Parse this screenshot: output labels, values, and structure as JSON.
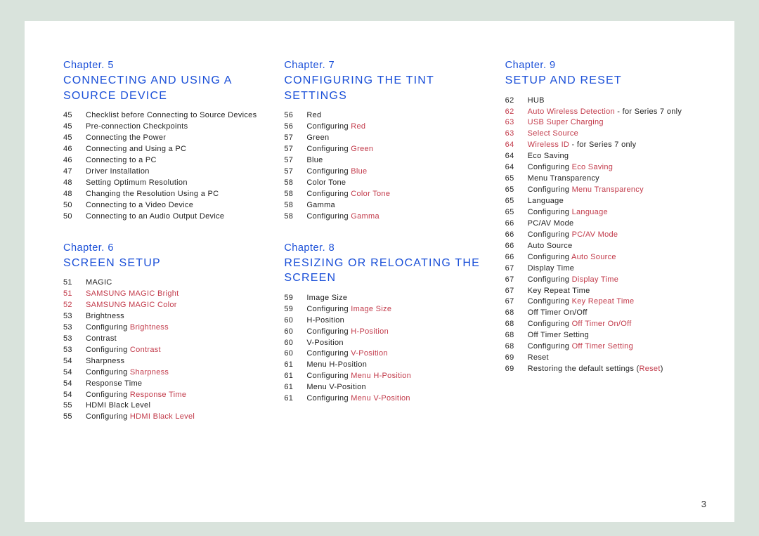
{
  "page_number": "3",
  "columns": [
    [
      {
        "num": "Chapter. 5",
        "title": "CONNECTING AND USING A SOURCE DEVICE",
        "items": [
          {
            "page": "45",
            "text": "Checklist before Connecting to Source Devices"
          },
          {
            "page": "45",
            "text": "Pre-connection Checkpoints"
          },
          {
            "page": "45",
            "text": "Connecting the Power"
          },
          {
            "page": "46",
            "text": "Connecting and Using a PC"
          },
          {
            "page": "46",
            "text": "Connecting to a PC"
          },
          {
            "page": "47",
            "text": "Driver Installation"
          },
          {
            "page": "48",
            "text": "Setting Optimum Resolution"
          },
          {
            "page": "48",
            "text": "Changing the Resolution Using a PC"
          },
          {
            "page": "50",
            "text": "Connecting to a Video Device"
          },
          {
            "page": "50",
            "text": "Connecting to an Audio Output Device"
          }
        ]
      },
      {
        "num": "Chapter. 6",
        "title": "SCREEN SETUP",
        "items": [
          {
            "page": "51",
            "text": "MAGIC"
          },
          {
            "page": "51",
            "text": "SAMSUNG MAGIC Bright",
            "style": "red"
          },
          {
            "page": "52",
            "text": "SAMSUNG MAGIC Color",
            "style": "red"
          },
          {
            "page": "53",
            "text": "Brightness"
          },
          {
            "page": "53",
            "prefix": "Configuring ",
            "red": "Brightness",
            "style": "mixed"
          },
          {
            "page": "53",
            "text": "Contrast"
          },
          {
            "page": "53",
            "prefix": "Configuring ",
            "red": "Contrast",
            "style": "mixed"
          },
          {
            "page": "54",
            "text": "Sharpness"
          },
          {
            "page": "54",
            "prefix": "Configuring ",
            "red": "Sharpness",
            "style": "mixed"
          },
          {
            "page": "54",
            "text": "Response Time"
          },
          {
            "page": "54",
            "prefix": "Configuring ",
            "red": "Response Time",
            "style": "mixed"
          },
          {
            "page": "55",
            "text": "HDMI Black Level"
          },
          {
            "page": "55",
            "prefix": "Configuring ",
            "red": "HDMI Black Level",
            "style": "mixed"
          }
        ]
      }
    ],
    [
      {
        "num": "Chapter. 7",
        "title": "CONFIGURING THE TINT SETTINGS",
        "items": [
          {
            "page": "56",
            "text": "Red"
          },
          {
            "page": "56",
            "prefix": "Configuring ",
            "red": "Red",
            "style": "mixed"
          },
          {
            "page": "57",
            "text": "Green"
          },
          {
            "page": "57",
            "prefix": "Configuring ",
            "red": "Green",
            "style": "mixed"
          },
          {
            "page": "57",
            "text": "Blue"
          },
          {
            "page": "57",
            "prefix": "Configuring ",
            "red": "Blue",
            "style": "mixed"
          },
          {
            "page": "58",
            "text": "Color Tone"
          },
          {
            "page": "58",
            "prefix": "Configuring ",
            "red": "Color Tone",
            "style": "mixed"
          },
          {
            "page": "58",
            "text": "Gamma"
          },
          {
            "page": "58",
            "prefix": "Configuring ",
            "red": "Gamma",
            "style": "mixed"
          }
        ]
      },
      {
        "num": "Chapter. 8",
        "title": "RESIZING OR RELOCATING THE SCREEN",
        "items": [
          {
            "page": "59",
            "text": "Image Size"
          },
          {
            "page": "59",
            "prefix": "Configuring ",
            "red": "Image Size",
            "style": "mixed"
          },
          {
            "page": "60",
            "text": "H-Position"
          },
          {
            "page": "60",
            "prefix": "Configuring ",
            "red": "H-Position",
            "style": "mixed"
          },
          {
            "page": "60",
            "text": "V-Position"
          },
          {
            "page": "60",
            "prefix": "Configuring ",
            "red": "V-Position",
            "style": "mixed"
          },
          {
            "page": "61",
            "text": "Menu H-Position"
          },
          {
            "page": "61",
            "prefix": "Configuring ",
            "red": "Menu H-Position",
            "style": "mixed"
          },
          {
            "page": "61",
            "text": "Menu V-Position"
          },
          {
            "page": "61",
            "prefix": "Configuring ",
            "red": "Menu V-Position",
            "style": "mixed"
          }
        ]
      }
    ],
    [
      {
        "num": "Chapter. 9",
        "title": "SETUP AND RESET",
        "items": [
          {
            "page": "62",
            "text": "HUB"
          },
          {
            "page": "62",
            "prefix": "",
            "red": "Auto Wireless Detection",
            "suffix": " - for Series 7 only",
            "style": "mixed2"
          },
          {
            "page": "63",
            "text": "USB Super Charging",
            "style": "red"
          },
          {
            "page": "63",
            "text": "Select Source",
            "style": "red"
          },
          {
            "page": "64",
            "prefix": "",
            "red": "Wireless ID",
            "suffix": " - for Series 7 only",
            "style": "mixed2"
          },
          {
            "page": "64",
            "text": "Eco Saving"
          },
          {
            "page": "64",
            "prefix": "Configuring ",
            "red": "Eco Saving",
            "style": "mixed"
          },
          {
            "page": "65",
            "text": "Menu Transparency"
          },
          {
            "page": "65",
            "prefix": "Configuring ",
            "red": "Menu Transparency",
            "style": "mixed"
          },
          {
            "page": "65",
            "text": "Language"
          },
          {
            "page": "65",
            "prefix": "Configuring ",
            "red": "Language",
            "style": "mixed"
          },
          {
            "page": "66",
            "text": "PC/AV Mode"
          },
          {
            "page": "66",
            "prefix": "Configuring ",
            "red": "PC/AV Mode",
            "style": "mixed"
          },
          {
            "page": "66",
            "text": "Auto Source"
          },
          {
            "page": "66",
            "prefix": "Configuring ",
            "red": "Auto Source",
            "style": "mixed"
          },
          {
            "page": "67",
            "text": "Display Time"
          },
          {
            "page": "67",
            "prefix": "Configuring ",
            "red": "Display Time",
            "style": "mixed"
          },
          {
            "page": "67",
            "text": "Key Repeat Time"
          },
          {
            "page": "67",
            "prefix": "Configuring ",
            "red": "Key Repeat Time",
            "style": "mixed"
          },
          {
            "page": "68",
            "text": "Off Timer On/Off"
          },
          {
            "page": "68",
            "prefix": "Configuring ",
            "red": "Off Timer On/Off",
            "style": "mixed"
          },
          {
            "page": "68",
            "text": "Off Timer Setting"
          },
          {
            "page": "68",
            "prefix": "Configuring ",
            "red": "Off Timer Setting",
            "style": "mixed"
          },
          {
            "page": "69",
            "text": "Reset"
          },
          {
            "page": "69",
            "prefix": "Restoring the default settings (",
            "red": "Reset",
            "suffix": ")",
            "style": "mixed2b"
          }
        ]
      }
    ]
  ]
}
